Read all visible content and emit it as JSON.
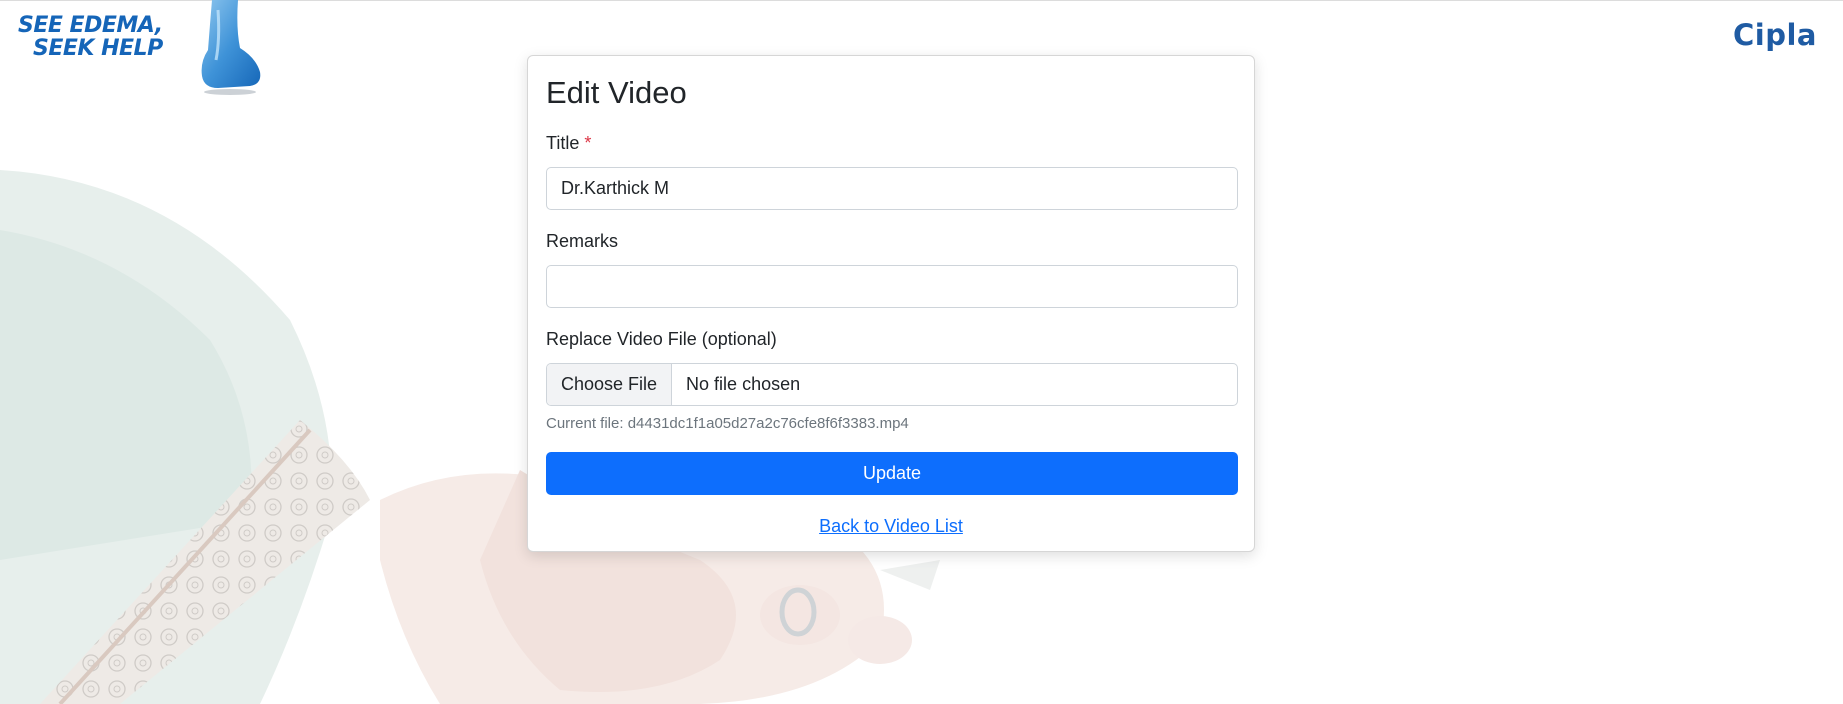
{
  "brand": {
    "campaign_line1": "SEE EDEMA,",
    "campaign_line2": "SEEK HELP",
    "company": "Cipla"
  },
  "form": {
    "heading": "Edit Video",
    "title_label": "Title",
    "required_mark": "*",
    "title_value": "Dr.Karthick M",
    "remarks_label": "Remarks",
    "remarks_value": "",
    "file_label": "Replace Video File (optional)",
    "file_button": "Choose File",
    "file_status": "No file chosen",
    "current_file_text": "Current file: d4431dc1f1a05d27a2c76cfe8f6f3383.mp4",
    "submit_label": "Update",
    "back_link": "Back to Video List"
  },
  "colors": {
    "primary": "#0d6efd",
    "brand_blue": "#1565b8",
    "required": "#dc3545"
  },
  "icons": {
    "foot": "foot-icon"
  }
}
